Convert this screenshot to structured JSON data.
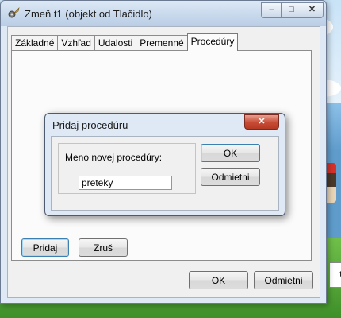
{
  "window": {
    "title": "Zmeň t1 (objekt od Tlačidlo)",
    "controls": {
      "minimize": "–",
      "maximize": "□",
      "close": "✕"
    },
    "icon": "gear-feather-icon"
  },
  "tabs": [
    {
      "label": "Základné"
    },
    {
      "label": "Vzhľad"
    },
    {
      "label": "Udalosti"
    },
    {
      "label": "Premenné"
    },
    {
      "label": "Procedúry",
      "active": true
    }
  ],
  "panel_buttons": {
    "add": "Pridaj",
    "remove": "Zruš"
  },
  "footer_buttons": {
    "ok": "OK",
    "cancel": "Odmietni"
  },
  "dialog": {
    "title": "Pridaj procedúru",
    "close": "✕",
    "field_label": "Meno novej procedúry:",
    "field_value": "preteky",
    "ok": "OK",
    "cancel": "Odmietni"
  },
  "background_box_text": "t"
}
